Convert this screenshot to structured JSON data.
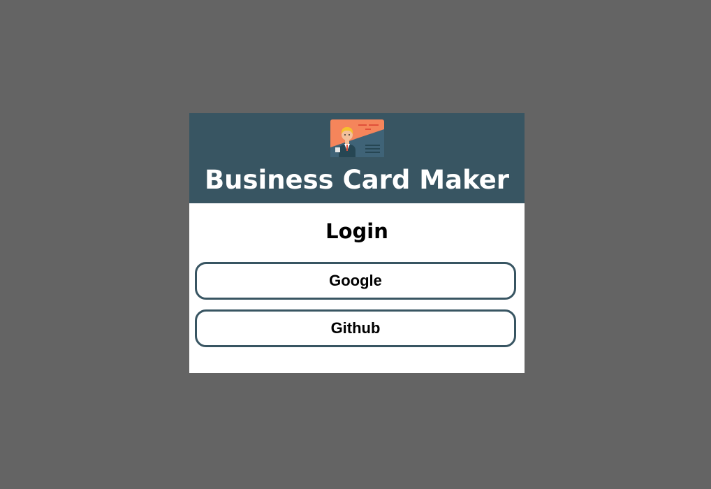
{
  "header": {
    "logo_icon": "business-card-icon",
    "title": "Business Card Maker"
  },
  "login": {
    "heading": "Login",
    "buttons": [
      {
        "label": "Google"
      },
      {
        "label": "Github"
      }
    ]
  },
  "colors": {
    "backdrop": "#646464",
    "header_bg": "#385562",
    "card_bg": "#ffffff",
    "button_border": "#385562",
    "logo_orange": "#f5855b",
    "logo_blue": "#385562"
  }
}
